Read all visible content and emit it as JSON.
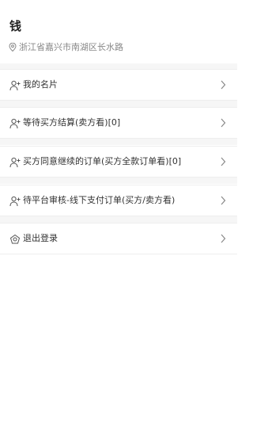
{
  "profile": {
    "name": "钱",
    "address": "浙江省嘉兴市南湖区长水路"
  },
  "menu": [
    {
      "label": "我的名片",
      "icon": "user-add-icon"
    },
    {
      "label": "等待买方结算(卖方看)[0]",
      "icon": "user-add-icon"
    },
    {
      "label": "买方同意继续的订单(买方全款订单看)[0]",
      "icon": "user-add-icon"
    },
    {
      "label": "待平台审核-线下支付订单(买方/卖方看)",
      "icon": "user-add-icon"
    },
    {
      "label": "退出登录",
      "icon": "logout-icon"
    }
  ],
  "colors": {
    "background": "#ffffff",
    "separator": "#f6f6f6",
    "text": "#333333",
    "muted": "#888888"
  }
}
